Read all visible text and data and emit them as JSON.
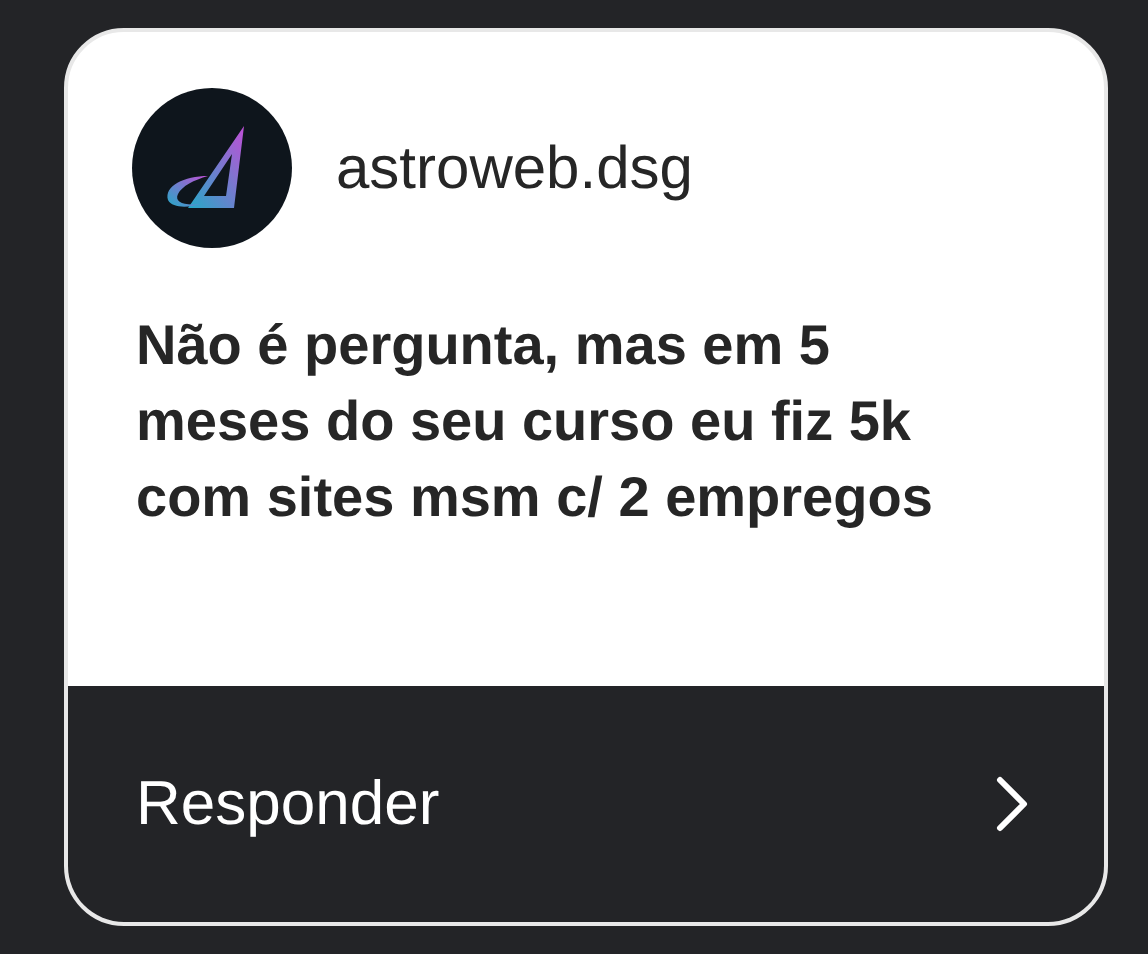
{
  "card": {
    "username": "astroweb.dsg",
    "question": "Não é pergunta, mas em 5 meses do seu curso eu fiz 5k com sites msm c/ 2 empregos",
    "reply_button": "Responder"
  }
}
